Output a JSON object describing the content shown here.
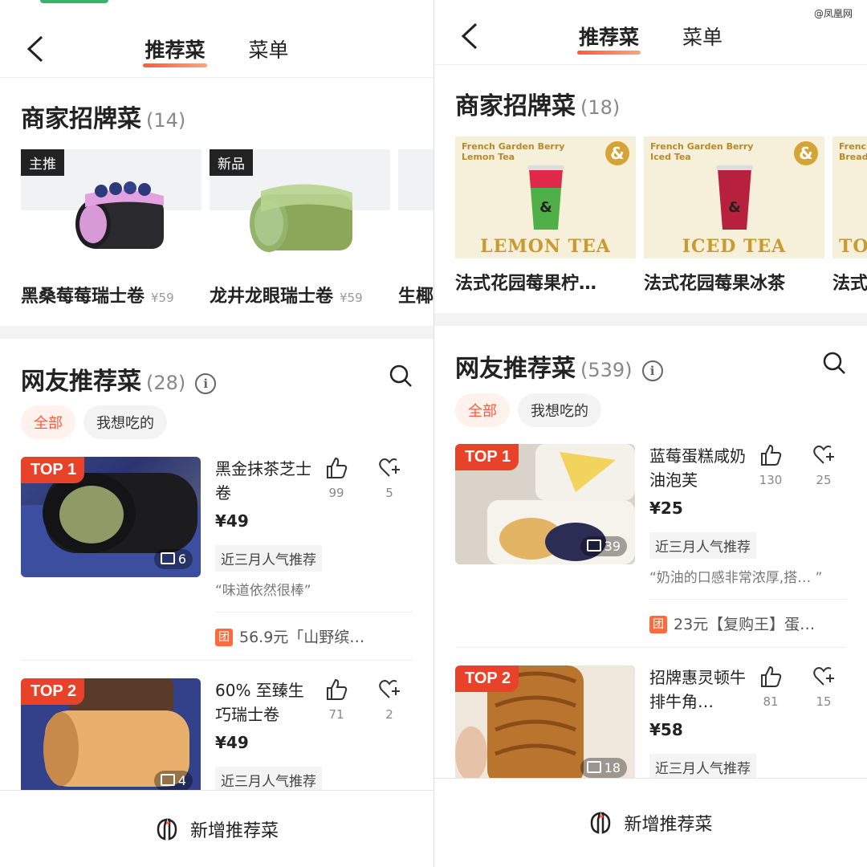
{
  "watermark": "@凤凰网",
  "left": {
    "tabs": [
      "推荐菜",
      "菜单"
    ],
    "signature": {
      "title": "商家招牌菜",
      "count": "(14)",
      "items": [
        {
          "badge": "主推",
          "name": "黑桑莓莓瑞士卷",
          "price": "¥59"
        },
        {
          "badge": "新品",
          "name": "龙井龙眼瑞士卷",
          "price": "¥59"
        },
        {
          "badge": "",
          "name": "生椰",
          "price": ""
        }
      ]
    },
    "netizen": {
      "title": "网友推荐菜",
      "count": "(28)",
      "info": "i",
      "chips": [
        "全部",
        "我想吃的"
      ],
      "dishes": [
        {
          "rank": "TOP 1",
          "photos": "6",
          "name": "黑金抹茶芝士卷",
          "price": "¥49",
          "likes": "99",
          "favs": "5",
          "tag": "近三月人气推荐",
          "quote": "“味道依然很棒”",
          "group": "56.9元「山野缤…",
          "group_icon": "团"
        },
        {
          "rank": "TOP 2",
          "photos": "4",
          "name": "60% 至臻生巧瑞士卷",
          "price": "¥49",
          "likes": "71",
          "favs": "2",
          "tag": "近三月人气推荐"
        }
      ]
    },
    "bottom": "新增推荐菜"
  },
  "right": {
    "tabs": [
      "推荐菜",
      "菜单"
    ],
    "signature": {
      "title": "商家招牌菜",
      "count": "(18)",
      "items": [
        {
          "name": "法式花园莓果柠…",
          "img_head": "French Garden Berry\nLemon Tea",
          "caption": "LEMON TEA"
        },
        {
          "name": "法式花园莓果冰茶",
          "img_head": "French Garden Berry\nIced Tea",
          "caption": "ICED TEA"
        },
        {
          "name": "法式",
          "img_head": "French\nBread",
          "caption": "TO"
        }
      ]
    },
    "netizen": {
      "title": "网友推荐菜",
      "count": "(539)",
      "info": "i",
      "chips": [
        "全部",
        "我想吃的"
      ],
      "dishes": [
        {
          "rank": "TOP 1",
          "photos": "39",
          "name": "蓝莓蛋糕咸奶油泡芙",
          "price": "¥25",
          "likes": "130",
          "favs": "25",
          "tag": "近三月人气推荐",
          "quote": "“奶油的口感非常浓厚,搭… ”",
          "group": "23元【复购王】蛋…",
          "group_icon": "团"
        },
        {
          "rank": "TOP 2",
          "photos": "18",
          "name": "招牌惠灵顿牛排牛角…",
          "price": "¥58",
          "likes": "81",
          "favs": "15",
          "tag": "近三月人气推荐"
        }
      ]
    },
    "bottom": "新增推荐菜"
  },
  "colors": {
    "accent": "#ff5a3c",
    "top_badge": "#e8432a",
    "gold": "#c99a30"
  }
}
